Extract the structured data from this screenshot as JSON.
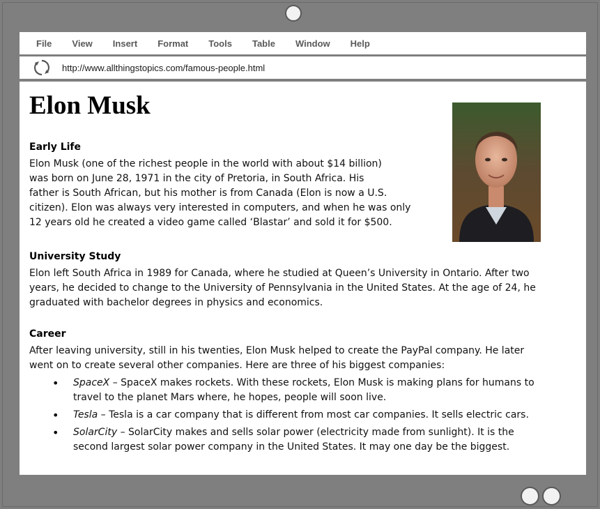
{
  "browser": {
    "menu": [
      "File",
      "View",
      "Insert",
      "Format",
      "Tools",
      "Table",
      "Window",
      "Help"
    ],
    "url": "http://www.allthingstopics.com/famous-people.html"
  },
  "page": {
    "title": "Elon Musk",
    "sections": {
      "early_life": {
        "heading": "Early Life",
        "lines": [
          "Elon Musk (one of the richest people in the world with about $14 billion)",
          "was born on June 28, 1971 in the city of Pretoria, in South Africa.   His",
          "father is South African, but his mother is from Canada (Elon is now a U.S.",
          "citizen). Elon was always very interested in computers, and when he was only",
          "12 years old he created a video game called ‘Blastar’ and sold it for $500."
        ]
      },
      "university": {
        "heading": "University Study",
        "lines": [
          "Elon left South Africa in 1989 for Canada, where he studied at Queen’s University in Ontario.  After two",
          "years, he decided to change to the University of Pennsylvania in the United States.  At the age of 24, he",
          "graduated with bachelor degrees in physics and economics."
        ]
      },
      "career": {
        "heading": "Career",
        "lines": [
          "After leaving university, still in his twenties, Elon Musk helped to create the PayPal company.  He later",
          "went on to create several other companies.  Here are three of his biggest companies:"
        ],
        "companies": [
          {
            "name": "SpaceX",
            "line1": " – SpaceX makes rockets.  With these rockets, Elon Musk is making plans for humans to",
            "line2": "travel to the planet Mars where, he hopes, people will soon live."
          },
          {
            "name": "Tesla",
            "line1": " – Tesla is a car company that is different from most car companies.  It sells electric cars.",
            "line2": ""
          },
          {
            "name": "SolarCity",
            "line1": " – SolarCity makes and sells solar power (electricity made from sunlight).  It is the",
            "line2": "second largest solar power company in the United States.  It may one day be the biggest."
          }
        ]
      }
    }
  },
  "colors": {
    "frame": "#7f7f7f",
    "menu_text": "#595959",
    "page_bg": "#ffffff"
  },
  "icons": {
    "refresh": "refresh-icon",
    "camera": "camera-icon"
  }
}
